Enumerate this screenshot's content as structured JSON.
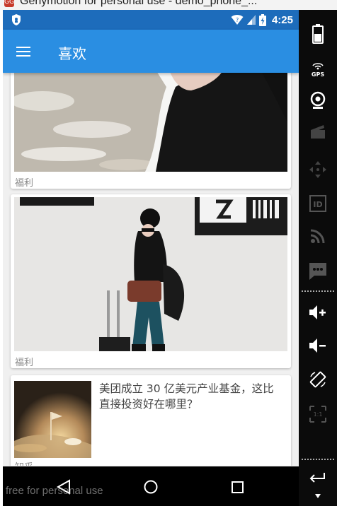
{
  "window": {
    "title": "Genymotion for personal use - demo_phone_..."
  },
  "statusbar": {
    "time": "4:25"
  },
  "appbar": {
    "title": "喜欢"
  },
  "cards": [
    {
      "tag": "福利"
    },
    {
      "tag": "福利"
    },
    {
      "headline": "美团成立 30 亿美元产业基金，这比直接投资好在哪里？",
      "tag": "知乎"
    }
  ],
  "watermark": "free for personal use",
  "sidepanel": {
    "gps_label": "GPS",
    "id_label": "ID",
    "icons": [
      "battery-icon",
      "gps-icon",
      "webcam-icon",
      "video-capture-icon",
      "move-icon",
      "identifier-icon",
      "rss-icon",
      "sms-icon",
      "volume-up-icon",
      "volume-down-icon",
      "rotate-icon",
      "pixel-ratio-icon",
      "back-icon",
      "menu-icon"
    ]
  },
  "colors": {
    "statusbar": "#1d6cbb",
    "appbar": "#2a8ee2",
    "navbar": "#000000"
  }
}
